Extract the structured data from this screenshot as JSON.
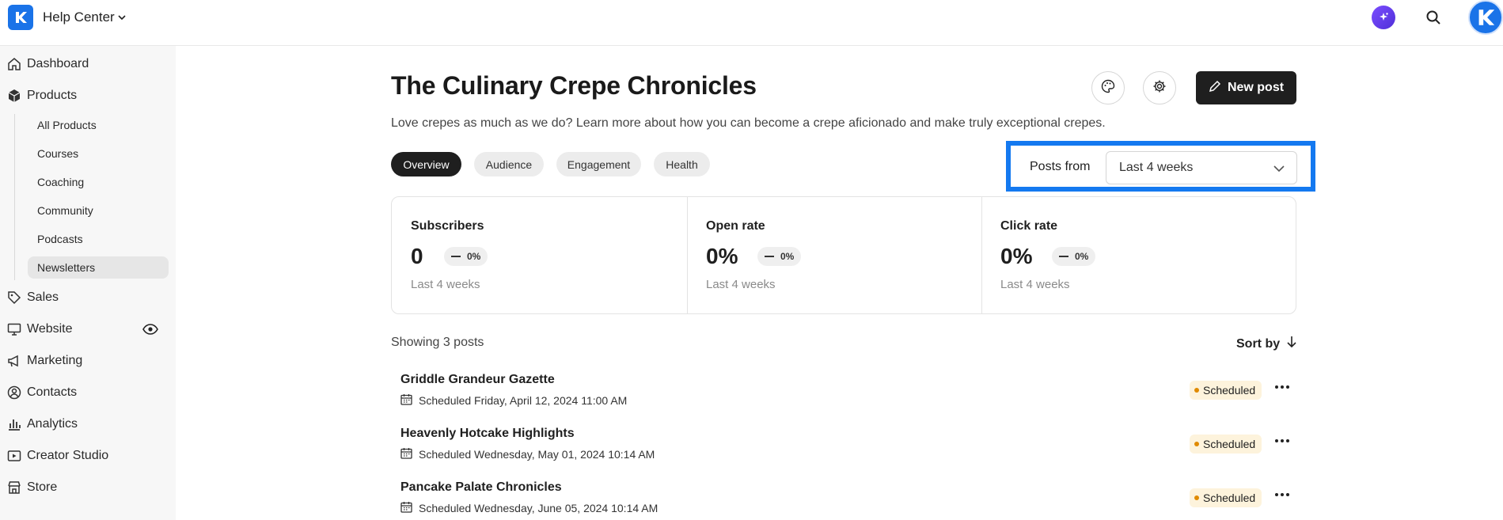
{
  "topbar": {
    "site_name": "Help Center",
    "icons": [
      "kajabi-logo-icon",
      "ai-sparkle-icon",
      "search-icon",
      "user-avatar"
    ]
  },
  "sidebar": {
    "items": [
      {
        "label": "Dashboard",
        "icon": "home-icon"
      },
      {
        "label": "Products",
        "icon": "box-icon"
      },
      {
        "label": "Sales",
        "icon": "tag-icon"
      },
      {
        "label": "Website",
        "icon": "monitor-icon"
      },
      {
        "label": "Marketing",
        "icon": "megaphone-icon"
      },
      {
        "label": "Contacts",
        "icon": "contact-icon"
      },
      {
        "label": "Analytics",
        "icon": "bar-chart-icon"
      },
      {
        "label": "Creator Studio",
        "icon": "studio-icon"
      },
      {
        "label": "Store",
        "icon": "store-icon"
      }
    ],
    "products_sub": [
      "All Products",
      "Courses",
      "Coaching",
      "Community",
      "Podcasts",
      "Newsletters"
    ],
    "active_sub": "Newsletters"
  },
  "main": {
    "title": "The Culinary Crepe Chronicles",
    "description": "Love crepes as much as we do? Learn more about how you can become a crepe aficionado and make truly exceptional crepes.",
    "new_post_label": "New post",
    "tabs": [
      "Overview",
      "Audience",
      "Engagement",
      "Health"
    ],
    "active_tab": "Overview",
    "posts_from_label": "Posts from",
    "posts_from_value": "Last 4 weeks",
    "stats": [
      {
        "title": "Subscribers",
        "value": "0",
        "change": "0%",
        "period": "Last 4 weeks"
      },
      {
        "title": "Open rate",
        "value": "0%",
        "change": "0%",
        "period": "Last 4 weeks"
      },
      {
        "title": "Click rate",
        "value": "0%",
        "change": "0%",
        "period": "Last 4 weeks"
      }
    ],
    "showing_text": "Showing 3 posts",
    "sort_label": "Sort by",
    "posts": [
      {
        "title": "Griddle Grandeur Gazette",
        "schedule": "Scheduled Friday, April 12, 2024 11:00 AM",
        "status": "Scheduled"
      },
      {
        "title": "Heavenly Hotcake Highlights",
        "schedule": "Scheduled Wednesday, May 01, 2024 10:14 AM",
        "status": "Scheduled"
      },
      {
        "title": "Pancake Palate Chronicles",
        "schedule": "Scheduled Wednesday, June 05, 2024 10:14 AM",
        "status": "Scheduled"
      }
    ]
  },
  "colors": {
    "accent": "#1479f0",
    "brand": "#1a73e8",
    "dark": "#1f1f1f",
    "scheduled_bg": "#fdf3dc",
    "scheduled_dot": "#e08a00"
  }
}
